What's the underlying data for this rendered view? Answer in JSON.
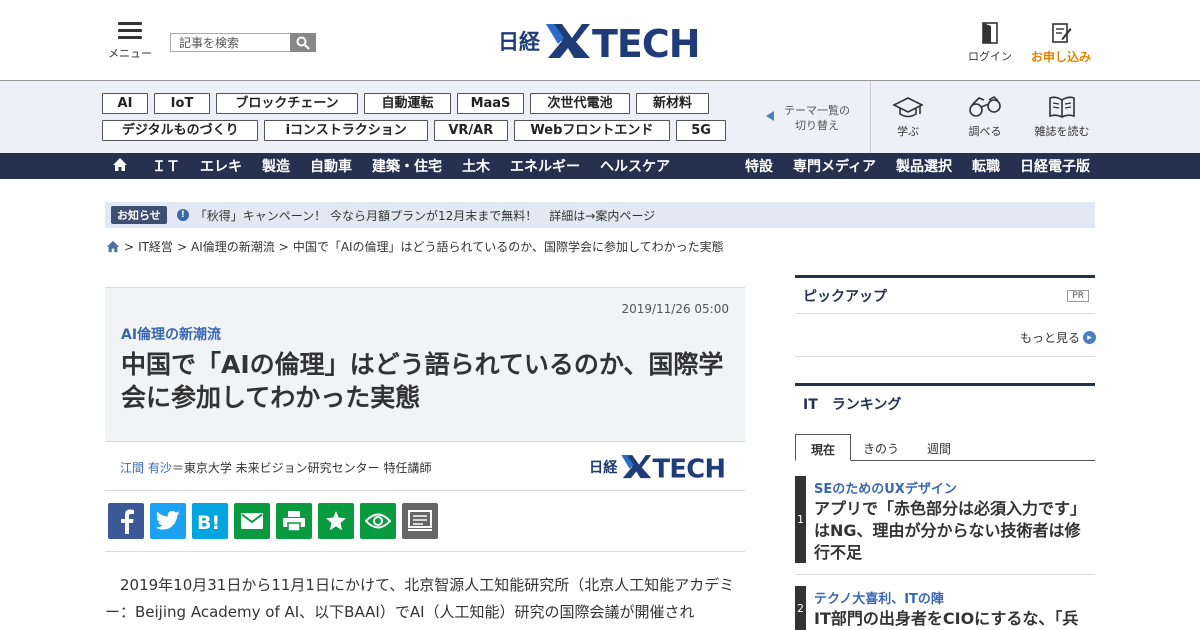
{
  "header": {
    "menu_label": "メニュー",
    "search_placeholder": "記事を検索",
    "logo_text": "日経 XTECH",
    "login_label": "ログイン",
    "apply_label": "お申し込み"
  },
  "theme_tags": [
    [
      "AI",
      "IoT",
      "ブロックチェーン",
      "自動運転",
      "MaaS",
      "次世代電池",
      "新材料"
    ],
    [
      "デジタルものづくり",
      "iコンストラクション",
      "VR/AR",
      "Webフロントエンド",
      "5G"
    ]
  ],
  "theme_switch": {
    "line1": "テーマ一覧の",
    "line2": "切り替え"
  },
  "tools": {
    "learn": "学ぶ",
    "research": "調べる",
    "magazine": "雑誌を読む"
  },
  "nav": {
    "left": [
      "ＩＴ",
      "エレキ",
      "製造",
      "自動車",
      "建築・住宅",
      "土木",
      "エネルギー",
      "ヘルスケア"
    ],
    "right": [
      "特設",
      "専門メディア",
      "製品選択",
      "転職",
      "日経電子版"
    ]
  },
  "notice": {
    "badge": "お知らせ",
    "text": "「秋得」キャンペーン！ 今なら月額プランが12月末まで無料！　詳細は→案内ページ"
  },
  "breadcrumb": [
    "IT経営",
    "AI倫理の新潮流",
    "中国で「AIの倫理」はどう語られているのか、国際学会に参加してわかった実態"
  ],
  "article": {
    "date": "2019/11/26 05:00",
    "category": "AI倫理の新潮流",
    "title": "中国で「AIの倫理」はどう語られているのか、国際学会に参加してわかった実態",
    "author_name": "江間 有沙",
    "author_affil": "＝東京大学 未来ビジョン研究センター 特任講師",
    "body": "2019年10月31日から11月1日にかけて、北京智源人工知能研究所（北京人工知能アカデミー：Beijing Academy of AI、以下BAAI）でAI（人工知能）研究の国際会議が開催され"
  },
  "sidebar": {
    "pickup_title": "ピックアップ",
    "pr_label": "PR",
    "more_label": "もっと見る",
    "ranking_title": "IT　ランキング",
    "tabs": [
      "現在",
      "きのう",
      "週間"
    ],
    "ranking": [
      {
        "num": "1",
        "cat": "SEのためのUXデザイン",
        "title": "アプリで「赤色部分は必須入力です」はNG、理由が分からない技術者は修行不足"
      },
      {
        "num": "2",
        "cat": "テクノ大喜利、ITの陣",
        "title": "IT部門の出身者をCIOにするな、「兵"
      }
    ]
  },
  "colors": {
    "navy": "#25314f",
    "accent_blue": "#3a68b0",
    "orange": "#e78200",
    "facebook": "#3b5998",
    "twitter": "#1da1f2",
    "hatena": "#00a4de",
    "green": "#0a9a3f",
    "gray": "#666666"
  }
}
